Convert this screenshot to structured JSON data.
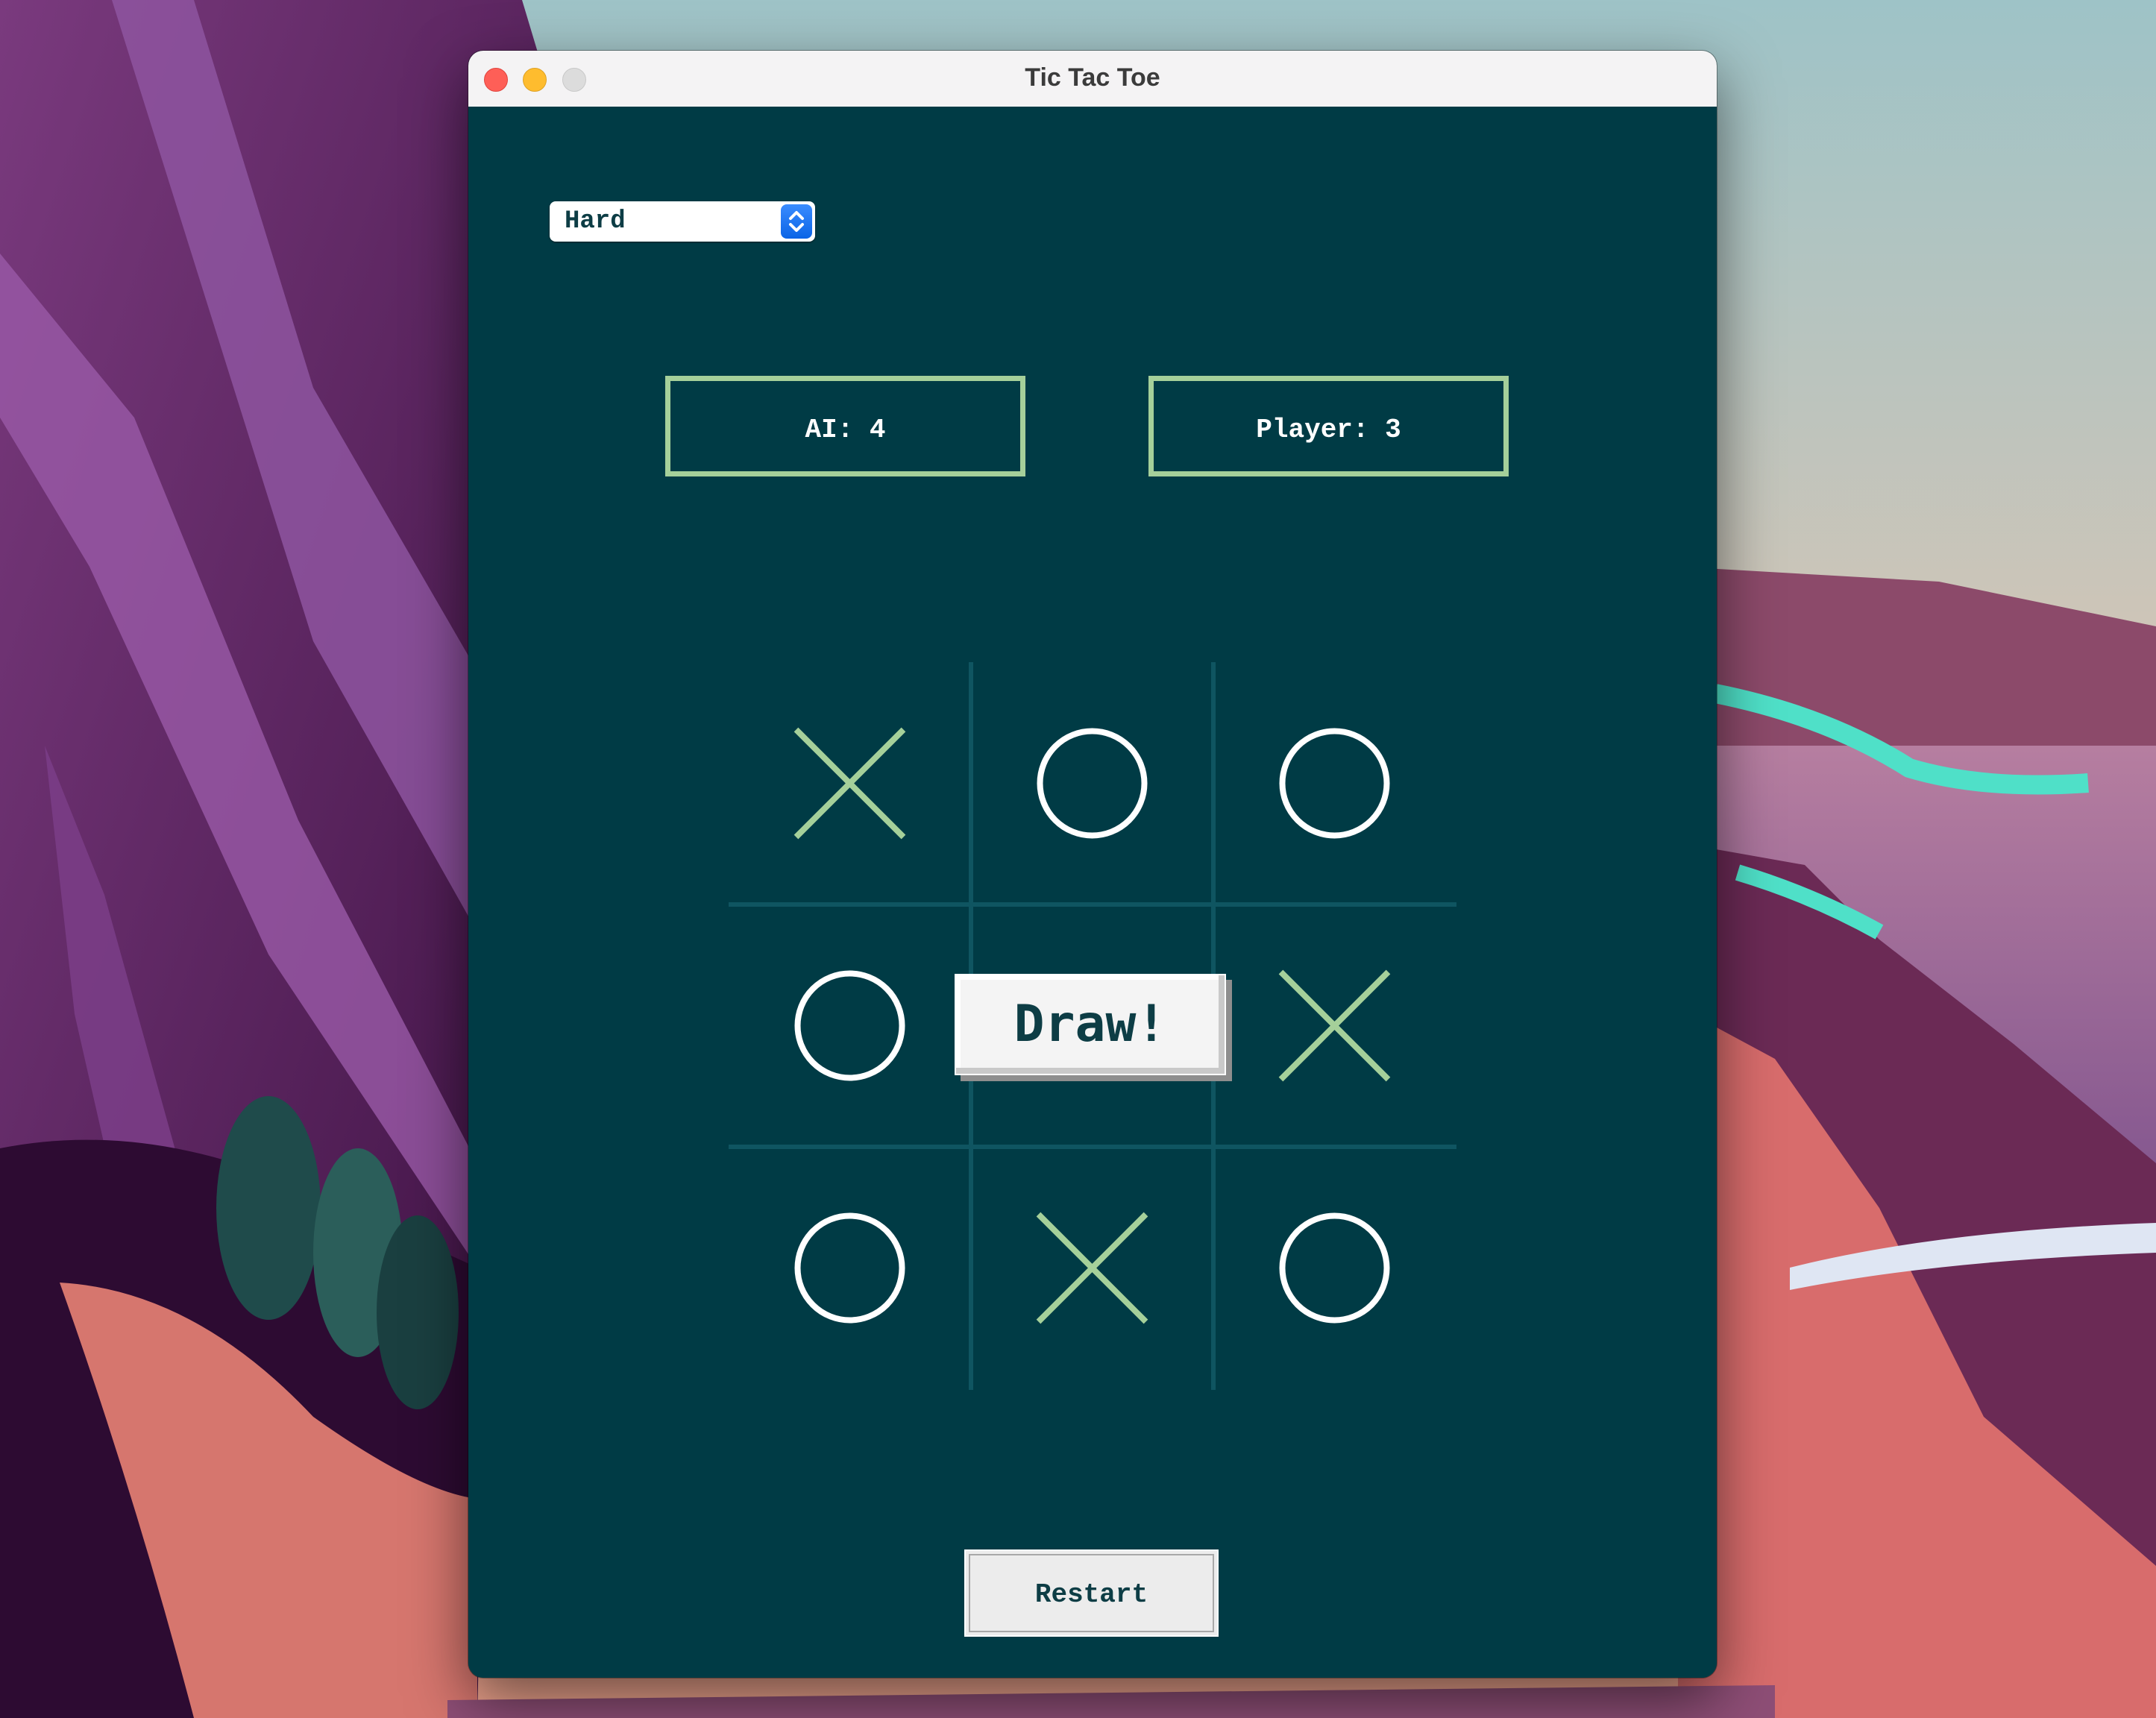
{
  "window": {
    "title": "Tic Tac Toe"
  },
  "difficulty": {
    "selected": "Hard"
  },
  "scores": {
    "ai": "AI: 4",
    "player": "Player: 3"
  },
  "board": {
    "cells": [
      "X",
      "O",
      "O",
      "O",
      "",
      "X",
      "O",
      "X",
      "O"
    ]
  },
  "result": {
    "message": "Draw!"
  },
  "controls": {
    "restart_label": "Restart"
  },
  "colors": {
    "background": "#003b45",
    "grid": "#0f5561",
    "x_mark": "#a5d09a",
    "o_mark": "#ffffff",
    "score_border": "#a5d09a"
  },
  "icons": {
    "close": "close-traffic-light",
    "minimize": "minimize-traffic-light",
    "zoom": "zoom-traffic-light",
    "select_stepper": "chevron-up-down-icon"
  }
}
